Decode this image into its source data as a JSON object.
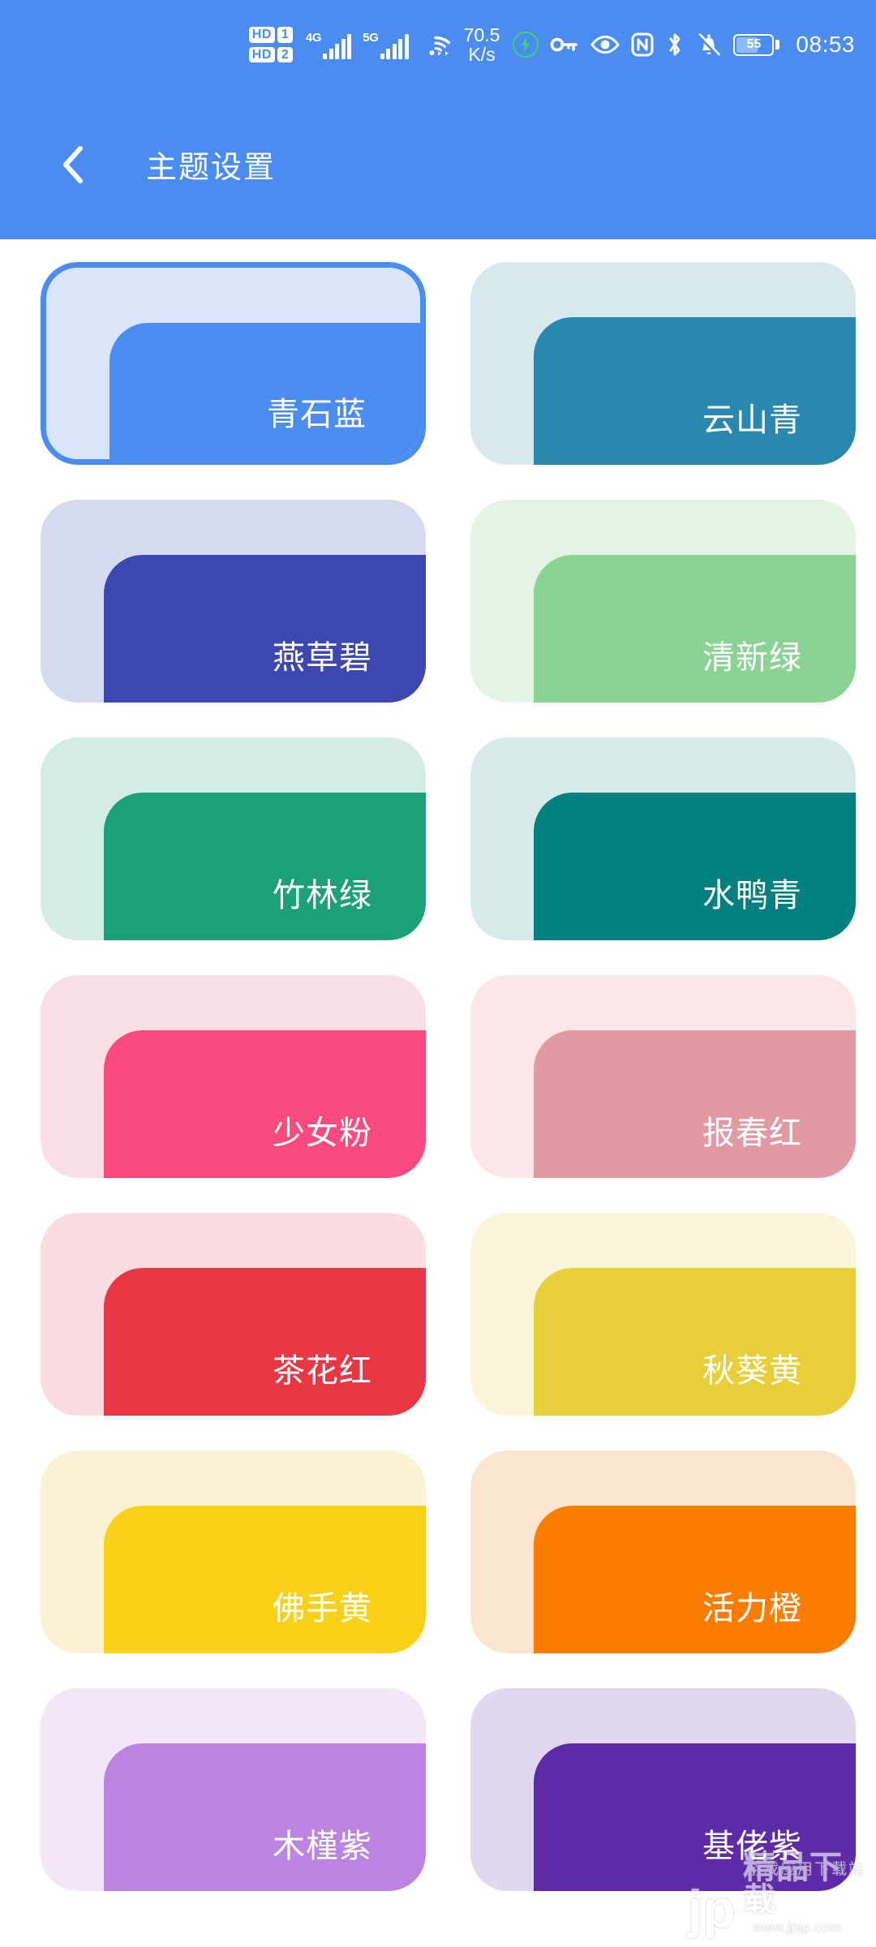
{
  "statusbar": {
    "sim1_hd": "HD",
    "sim1_num": "1",
    "sim2_hd": "HD",
    "sim2_num": "2",
    "net1_label": "4G",
    "net2_label": "5G",
    "speed_value": "70.5",
    "speed_unit": "K/s",
    "battery_percent": "55",
    "clock": "08:53",
    "icons": [
      "sim-hd-1-icon",
      "sim-hd-2-icon",
      "signal-4g-icon",
      "signal-5g-icon",
      "wifi-icon",
      "network-speed-indicator",
      "fast-charge-icon",
      "vpn-key-icon",
      "eye-care-icon",
      "nfc-icon",
      "bluetooth-icon",
      "silent-bell-icon",
      "battery-icon",
      "clock-text"
    ]
  },
  "appbar": {
    "back_icon": "chevron-left-icon",
    "title": "主题设置"
  },
  "themes": [
    {
      "name": "青石蓝",
      "outer": "#dae5fb",
      "inner": "#4a8cf0",
      "selected": true
    },
    {
      "name": "云山青",
      "outer": "#d8e9ee",
      "inner": "#2a87ae",
      "selected": false
    },
    {
      "name": "燕草碧",
      "outer": "#d6daf0",
      "inner": "#3c47b0",
      "selected": false
    },
    {
      "name": "清新绿",
      "outer": "#e4f3e6",
      "inner": "#8bd295",
      "selected": false
    },
    {
      "name": "竹林绿",
      "outer": "#d5ece4",
      "inner": "#1ba077",
      "selected": false
    },
    {
      "name": "水鸭青",
      "outer": "#d8eaea",
      "inner": "#00807f",
      "selected": false
    },
    {
      "name": "少女粉",
      "outer": "#fbdfe7",
      "inner": "#fb4a7f",
      "selected": false
    },
    {
      "name": "报春红",
      "outer": "#fbe7e7",
      "inner": "#e29aa2",
      "selected": false
    },
    {
      "name": "茶花红",
      "outer": "#fbdde1",
      "inner": "#e83744",
      "selected": false
    },
    {
      "name": "秋葵黄",
      "outer": "#faf4da",
      "inner": "#e8ce3b",
      "selected": false
    },
    {
      "name": "佛手黄",
      "outer": "#fbf2d6",
      "inner": "#fad119",
      "selected": false
    },
    {
      "name": "活力橙",
      "outer": "#fbe4d0",
      "inner": "#fb7d00",
      "selected": false
    },
    {
      "name": "木槿紫",
      "outer": "#f2e6f7",
      "inner": "#bc84e0",
      "selected": false
    },
    {
      "name": "基佬紫",
      "outer": "#dfd8ef",
      "inner": "#5d2ba8",
      "selected": false
    }
  ],
  "watermark": {
    "logo": "jp",
    "main": "精品下载",
    "sub": "游戏应用下载站",
    "url": "www.jpjp.com"
  },
  "colors": {
    "accent": "#4a8cf0",
    "page_bg": "#ffffff",
    "status_text": "#ffffff"
  }
}
